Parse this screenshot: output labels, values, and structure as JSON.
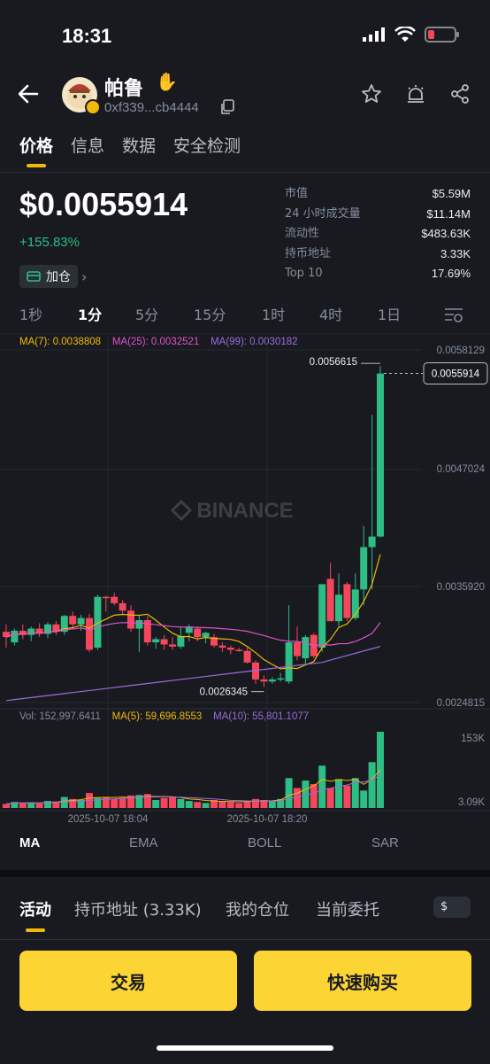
{
  "status_bar": {
    "time": "18:31"
  },
  "header": {
    "token_name": "帕鲁",
    "address": "0xf339...cb4444"
  },
  "tabs": [
    {
      "label": "价格"
    },
    {
      "label": "信息"
    },
    {
      "label": "数据"
    },
    {
      "label": "安全检测"
    }
  ],
  "price": {
    "value": "$0.0055914",
    "change": "+155.83%",
    "add_position_label": "加仓"
  },
  "stats": [
    {
      "label": "市值",
      "value": "$5.59M"
    },
    {
      "label": "24 小时成交量",
      "value": "$11.14M"
    },
    {
      "label": "流动性",
      "value": "$483.63K"
    },
    {
      "label": "持币地址",
      "value": "3.33K"
    },
    {
      "label": "Top 10",
      "value": "17.69%"
    }
  ],
  "intervals": [
    {
      "label": "1秒"
    },
    {
      "label": "1分"
    },
    {
      "label": "5分"
    },
    {
      "label": "15分"
    },
    {
      "label": "1时"
    },
    {
      "label": "4时"
    },
    {
      "label": "1日"
    }
  ],
  "ma_legend": {
    "ma7": "MA(7): 0.0038808",
    "ma25": "MA(25): 0.0032521",
    "ma99": "MA(99): 0.0030182"
  },
  "vol_legend": {
    "vol": "Vol: 152,997.6411",
    "ma5": "MA(5): 59,696.8553",
    "ma10": "MA(10): 55,801.1077"
  },
  "chart_data": {
    "type": "candlestick",
    "watermark": "BINANCE",
    "y_axis_labels": [
      "0.0058129",
      "0.0047024",
      "0.0035920",
      "0.0024815"
    ],
    "ylim": [
      0.0024815,
      0.0058129
    ],
    "current_price_label": "0.0055914",
    "high_marker": "0.0056615",
    "low_marker": "0.0026345",
    "x_labels": [
      "2025-10-07 18:04",
      "2025-10-07 18:20"
    ],
    "volume_axis_labels": [
      "153K",
      "3.09K"
    ],
    "candles": [
      {
        "o": 0.00315,
        "h": 0.00322,
        "l": 0.003,
        "c": 0.0031
      },
      {
        "o": 0.00305,
        "h": 0.00318,
        "l": 0.00302,
        "c": 0.00316
      },
      {
        "o": 0.00316,
        "h": 0.00322,
        "l": 0.00308,
        "c": 0.00312
      },
      {
        "o": 0.00312,
        "h": 0.0032,
        "l": 0.00306,
        "c": 0.00318
      },
      {
        "o": 0.00318,
        "h": 0.00323,
        "l": 0.0031,
        "c": 0.00313
      },
      {
        "o": 0.00313,
        "h": 0.00324,
        "l": 0.00309,
        "c": 0.00322
      },
      {
        "o": 0.00322,
        "h": 0.00325,
        "l": 0.00312,
        "c": 0.00315
      },
      {
        "o": 0.00315,
        "h": 0.00331,
        "l": 0.00312,
        "c": 0.0033
      },
      {
        "o": 0.0033,
        "h": 0.00334,
        "l": 0.00318,
        "c": 0.00322
      },
      {
        "o": 0.00322,
        "h": 0.00331,
        "l": 0.00316,
        "c": 0.00328
      },
      {
        "o": 0.00328,
        "h": 0.00332,
        "l": 0.00296,
        "c": 0.00298
      },
      {
        "o": 0.003,
        "h": 0.0035,
        "l": 0.00298,
        "c": 0.00348
      },
      {
        "o": 0.00348,
        "h": 0.00349,
        "l": 0.00334,
        "c": 0.00347
      },
      {
        "o": 0.00348,
        "h": 0.00352,
        "l": 0.0034,
        "c": 0.00342
      },
      {
        "o": 0.00342,
        "h": 0.00345,
        "l": 0.00332,
        "c": 0.00335
      },
      {
        "o": 0.00335,
        "h": 0.0034,
        "l": 0.00315,
        "c": 0.00318
      },
      {
        "o": 0.00318,
        "h": 0.0033,
        "l": 0.00296,
        "c": 0.00326
      },
      {
        "o": 0.00326,
        "h": 0.0033,
        "l": 0.00302,
        "c": 0.00305
      },
      {
        "o": 0.00305,
        "h": 0.0031,
        "l": 0.00299,
        "c": 0.00308
      },
      {
        "o": 0.00308,
        "h": 0.00312,
        "l": 0.00298,
        "c": 0.00303
      },
      {
        "o": 0.00303,
        "h": 0.0031,
        "l": 0.00298,
        "c": 0.00301
      },
      {
        "o": 0.00301,
        "h": 0.0032,
        "l": 0.00299,
        "c": 0.00311
      },
      {
        "o": 0.00314,
        "h": 0.00322,
        "l": 0.00306,
        "c": 0.0032
      },
      {
        "o": 0.00318,
        "h": 0.0032,
        "l": 0.00306,
        "c": 0.0031
      },
      {
        "o": 0.0031,
        "h": 0.00315,
        "l": 0.00304,
        "c": 0.00314
      },
      {
        "o": 0.0031,
        "h": 0.00313,
        "l": 0.003,
        "c": 0.00302
      },
      {
        "o": 0.00302,
        "h": 0.00305,
        "l": 0.00296,
        "c": 0.003
      },
      {
        "o": 0.003,
        "h": 0.00302,
        "l": 0.00294,
        "c": 0.00298
      },
      {
        "o": 0.00298,
        "h": 0.003,
        "l": 0.00296,
        "c": 0.00297
      },
      {
        "o": 0.00297,
        "h": 0.003,
        "l": 0.00285,
        "c": 0.00286
      },
      {
        "o": 0.00286,
        "h": 0.00288,
        "l": 0.00266,
        "c": 0.0027
      },
      {
        "o": 0.0027,
        "h": 0.00274,
        "l": 0.00263,
        "c": 0.00268
      },
      {
        "o": 0.00268,
        "h": 0.00272,
        "l": 0.00266,
        "c": 0.0027
      },
      {
        "o": 0.0027,
        "h": 0.00276,
        "l": 0.00268,
        "c": 0.00271
      },
      {
        "o": 0.00268,
        "h": 0.0034,
        "l": 0.00266,
        "c": 0.00305
      },
      {
        "o": 0.00305,
        "h": 0.0032,
        "l": 0.00288,
        "c": 0.00292
      },
      {
        "o": 0.0029,
        "h": 0.00312,
        "l": 0.00284,
        "c": 0.0031
      },
      {
        "o": 0.00312,
        "h": 0.00314,
        "l": 0.0029,
        "c": 0.00292
      },
      {
        "o": 0.003,
        "h": 0.0034,
        "l": 0.00296,
        "c": 0.0036
      },
      {
        "o": 0.00365,
        "h": 0.0038,
        "l": 0.00325,
        "c": 0.00325
      },
      {
        "o": 0.00325,
        "h": 0.0037,
        "l": 0.0032,
        "c": 0.0035
      },
      {
        "o": 0.0036,
        "h": 0.00362,
        "l": 0.00325,
        "c": 0.00328
      },
      {
        "o": 0.00328,
        "h": 0.0037,
        "l": 0.00326,
        "c": 0.00355
      },
      {
        "o": 0.00355,
        "h": 0.00415,
        "l": 0.0034,
        "c": 0.00395
      },
      {
        "o": 0.00395,
        "h": 0.0052,
        "l": 0.00355,
        "c": 0.00405
      },
      {
        "o": 0.00405,
        "h": 0.00566,
        "l": 0.00404,
        "c": 0.00559
      }
    ],
    "volumes": [
      8,
      12,
      10,
      11,
      9,
      14,
      13,
      22,
      18,
      16,
      30,
      20,
      22,
      18,
      20,
      25,
      26,
      28,
      16,
      20,
      22,
      18,
      14,
      12,
      10,
      16,
      14,
      12,
      10,
      14,
      18,
      16,
      14,
      18,
      60,
      40,
      55,
      48,
      85,
      40,
      58,
      45,
      60,
      35,
      92,
      153
    ]
  },
  "indicator_tabs": [
    {
      "label": "MA"
    },
    {
      "label": "EMA"
    },
    {
      "label": "BOLL"
    },
    {
      "label": "SAR"
    }
  ],
  "activity_tabs": [
    {
      "label": "活动"
    },
    {
      "label": "持币地址 (3.33K)"
    },
    {
      "label": "我的仓位"
    },
    {
      "label": "当前委托"
    }
  ],
  "currency_toggle": "$",
  "buttons": {
    "trade": "交易",
    "quick_buy": "快速购买"
  },
  "colors": {
    "up": "#2ebd85",
    "down": "#f6465d",
    "accent": "#fcd535",
    "ma7": "#f0b90b",
    "ma25": "#e052c8",
    "ma99": "#9b6cdc"
  }
}
